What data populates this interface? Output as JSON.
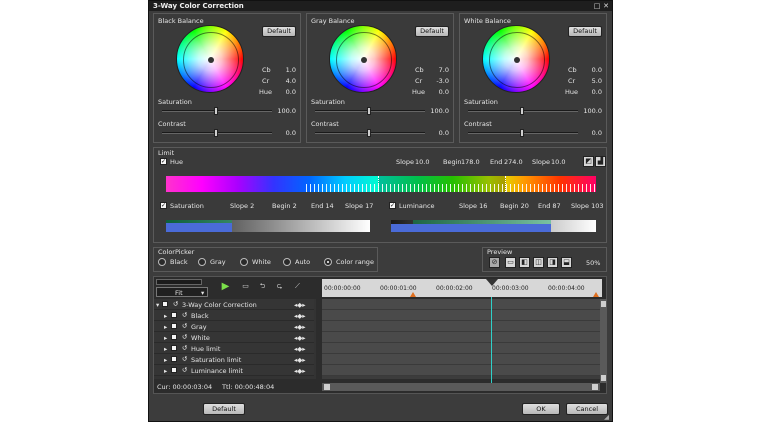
{
  "window": {
    "title": "3-Way Color Correction"
  },
  "balance": [
    {
      "label": "Black Balance",
      "default_label": "Default",
      "cb": "1.0",
      "cr": "4.0",
      "hue": "0.0",
      "saturation": "100.0",
      "contrast": "0.0"
    },
    {
      "label": "Gray Balance",
      "default_label": "Default",
      "cb": "7.0",
      "cr": "-3.0",
      "hue": "0.0",
      "saturation": "100.0",
      "contrast": "0.0"
    },
    {
      "label": "White Balance",
      "default_label": "Default",
      "cb": "0.0",
      "cr": "5.0",
      "hue": "0.0",
      "saturation": "100.0",
      "contrast": "0.0"
    }
  ],
  "balance_labels": {
    "cb": "Cb",
    "cr": "Cr",
    "hue": "Hue",
    "saturation": "Saturation",
    "contrast": "Contrast"
  },
  "limit": {
    "label": "Limit",
    "hue": {
      "label": "Hue",
      "slope_label": "Slope",
      "slope1": "10.0",
      "begin_label": "Begin",
      "begin": "178.0",
      "end_label": "End",
      "end": "274.0",
      "slope2": "10.0"
    },
    "saturation": {
      "label": "Saturation",
      "slope1_text": "Slope 2",
      "begin_text": "Begin 2",
      "end_text": "End 14",
      "slope2_text": "Slope 17"
    },
    "luminance": {
      "label": "Luminance",
      "slope1_text": "Slope 16",
      "begin_text": "Begin 20",
      "end_text": "End 87",
      "slope2_text": "Slope 103"
    }
  },
  "colorpicker": {
    "label": "ColorPicker",
    "options": [
      "Black",
      "Gray",
      "White",
      "Auto",
      "Color range"
    ],
    "selected": "Color range"
  },
  "preview": {
    "label": "Preview",
    "zoom": "50%"
  },
  "timeline": {
    "fit_label": "Fit",
    "timecodes": [
      "00:00:00:00",
      "00:00:01:00",
      "00:00:02:00",
      "00:00:03:00",
      "00:00:04:00"
    ],
    "tracks": [
      "3-Way Color Correction",
      "Black",
      "Gray",
      "White",
      "Hue limit",
      "Saturation limit",
      "Luminance limit"
    ],
    "cur_label": "Cur: 00:00:03:04",
    "ttl_label": "Ttl: 00:00:48:04"
  },
  "footer": {
    "default_label": "Default",
    "ok_label": "OK",
    "cancel_label": "Cancel"
  }
}
